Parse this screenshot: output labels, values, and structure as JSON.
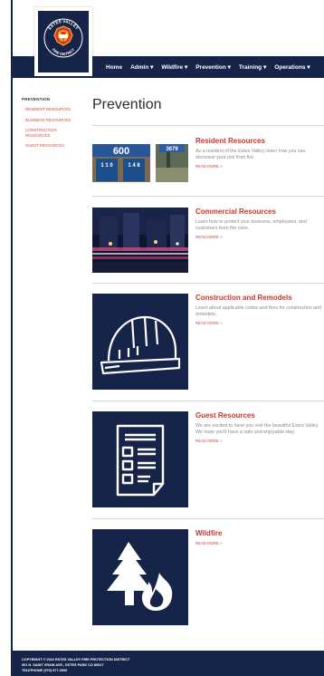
{
  "nav": {
    "items": [
      "Home",
      "Admin ▾",
      "Wildfire ▾",
      "Prevention ▾",
      "Training ▾",
      "Operations ▾"
    ]
  },
  "logo": {
    "top_text": "ESTES VALLEY",
    "bottom_text": "FIRE DISTRICT"
  },
  "sidebar": {
    "title": "PREVENTION",
    "items": [
      "RESIDENT RESOURCES",
      "BUSINESS RESOURCES",
      "CONSTRUCTION RESOURCES",
      "GUEST RESOURCES"
    ]
  },
  "main": {
    "title": "Prevention",
    "cards": [
      {
        "title": "Resident Resources",
        "desc": "As a resident of the Estes Valley, learn how you can decrease your risk from fire.",
        "more": "READ MORE »",
        "icon": "address-signs-photo",
        "sign_number_1": "600",
        "sign_number_2": "1 1 0",
        "sign_number_3": "1 4 8",
        "sign_number_4": "3679"
      },
      {
        "title": "Commercial Resources",
        "desc": "Learn how to protect your business, employees, and customers from fire risks.",
        "more": "READ MORE »",
        "icon": "night-street-photo"
      },
      {
        "title": "Construction and Remodels",
        "desc": "Learn about applicable codes and fees for construction and remodels.",
        "more": "READ MORE »",
        "icon": "hard-hat-icon"
      },
      {
        "title": "Guest Resources",
        "desc": "We are excited to have you visit the beautiful Estes Valley. We hope you'll have a safe and enjoyable stay.",
        "more": "READ MORE »",
        "icon": "checklist-icon"
      },
      {
        "title": "Wildfire",
        "desc": "",
        "more": "READ MORE »",
        "icon": "tree-fire-icon"
      }
    ]
  },
  "footer": {
    "line1": "COPYRIGHT © 2022 ESTES VALLEY FIRE PROTECTION DISTRICT",
    "line2": "901 N. SAINT VRAIN AVE., ESTES PARK CO 80517",
    "line3": "TELEPHONE (970) 577-0900"
  },
  "colors": {
    "navy": "#17244a",
    "accent_red": "#c9352c"
  }
}
